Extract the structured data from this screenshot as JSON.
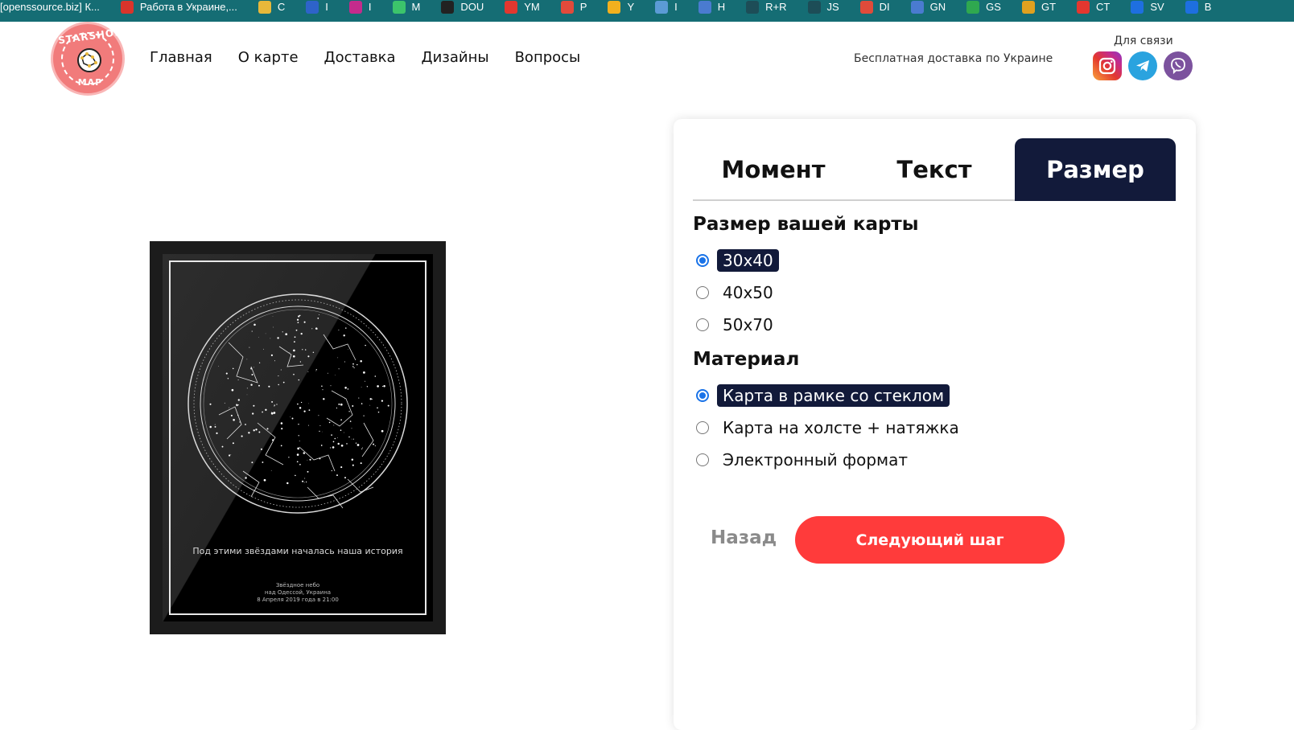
{
  "bookmarks": [
    {
      "label": "[openssource.biz] К...",
      "color": "#156d74"
    },
    {
      "label": "Работа в Украине,...",
      "color": "#d9342b"
    },
    {
      "label": "С",
      "color": "#e8b83a"
    },
    {
      "label": "I",
      "color": "#2e63c9"
    },
    {
      "label": "I",
      "color": "#c42b8c"
    },
    {
      "label": "M",
      "color": "#3cc46b"
    },
    {
      "label": "DOU",
      "color": "#222222"
    },
    {
      "label": "YM",
      "color": "#e3372f"
    },
    {
      "label": "P",
      "color": "#e24a3b"
    },
    {
      "label": "Y",
      "color": "#f2b01e"
    },
    {
      "label": "I",
      "color": "#5b9bd5"
    },
    {
      "label": "H",
      "color": "#4a7bd0"
    },
    {
      "label": "R+R",
      "color": "#1d4d57"
    },
    {
      "label": "JS",
      "color": "#1d4d57"
    },
    {
      "label": "DI",
      "color": "#e04b3a"
    },
    {
      "label": "GN",
      "color": "#4a7bd0"
    },
    {
      "label": "GS",
      "color": "#2fa84f"
    },
    {
      "label": "GT",
      "color": "#e0a11f"
    },
    {
      "label": "CT",
      "color": "#e3372f"
    },
    {
      "label": "SV",
      "color": "#1e6fe0"
    },
    {
      "label": "B",
      "color": "#1e6fe0"
    }
  ],
  "logo": {
    "top_text": "STARSHONEY",
    "bottom_text": "MAP"
  },
  "nav": [
    "Главная",
    "О карте",
    "Доставка",
    "Дизайны",
    "Вопросы"
  ],
  "header": {
    "delivery": "Бесплатная доставка по Украине",
    "contact_title": "Для связи",
    "socials": [
      "instagram-icon",
      "telegram-icon",
      "viber-icon"
    ]
  },
  "poster": {
    "caption": "Под этими звёздами началась наша история",
    "sub1": "Звёздное небо",
    "sub2": "над Одессой, Украина",
    "sub3": "8 Апреля 2019 года в 21:00"
  },
  "tabs": [
    {
      "label": "Момент",
      "active": false
    },
    {
      "label": "Текст",
      "active": false
    },
    {
      "label": "Размер",
      "active": true
    }
  ],
  "size_section": {
    "title": "Размер вашей карты",
    "options": [
      {
        "label": "30x40",
        "checked": true
      },
      {
        "label": "40x50",
        "checked": false
      },
      {
        "label": "50x70",
        "checked": false
      }
    ]
  },
  "material_section": {
    "title": "Материал",
    "options": [
      {
        "label": "Карта в рамке со стеклом",
        "checked": true
      },
      {
        "label": "Карта на холсте + натяжка",
        "checked": false
      },
      {
        "label": "Электронный формат",
        "checked": false
      }
    ]
  },
  "buttons": {
    "back": "Назад",
    "next": "Следующий шаг"
  },
  "colors": {
    "accent": "#ff3b3b",
    "navy": "#121a3a",
    "bar": "#156d74"
  }
}
